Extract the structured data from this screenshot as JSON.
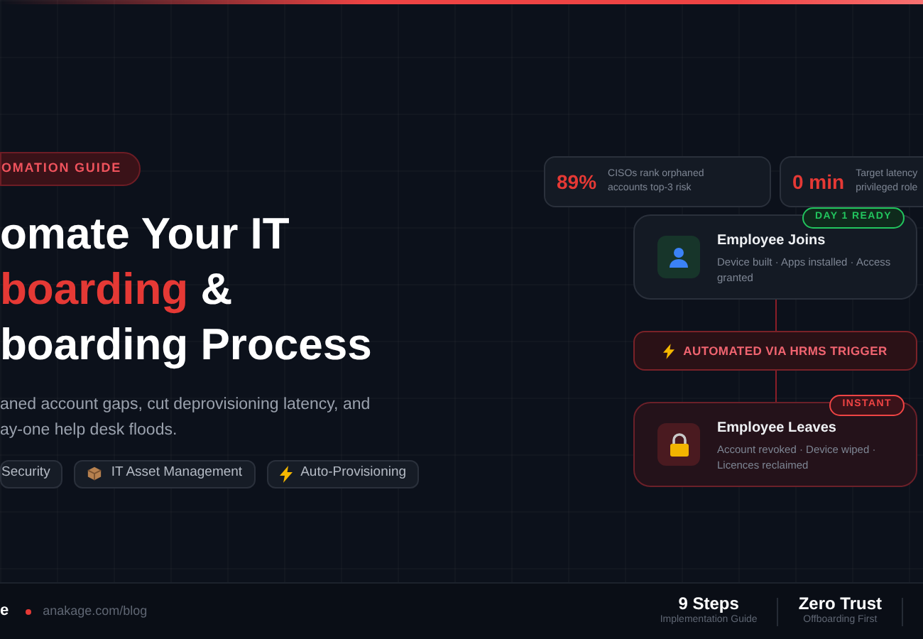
{
  "badge": "OMATION GUIDE",
  "title_lines": [
    {
      "segments": [
        {
          "text": "omate Your IT",
          "accent": false
        }
      ]
    },
    {
      "segments": [
        {
          "text": "boarding",
          "accent": true
        },
        {
          "text": " &",
          "accent": false
        }
      ]
    },
    {
      "segments": [
        {
          "text": "boarding Process",
          "accent": false
        }
      ]
    }
  ],
  "description_lines": [
    "aned account gaps, cut deprovisioning latency, and",
    "ay-one help desk floods."
  ],
  "tags": [
    {
      "kind": "plain",
      "label": "Security"
    },
    {
      "kind": "box",
      "label": "IT Asset Management"
    },
    {
      "kind": "bolt",
      "label": "Auto-Provisioning"
    }
  ],
  "stats": [
    {
      "value": "89%",
      "caption_lines": [
        "CISOs rank orphaned",
        "accounts top-3 risk"
      ]
    },
    {
      "value": "0 min",
      "caption_lines": [
        "Target latency",
        "privileged role"
      ]
    }
  ],
  "flow": [
    {
      "kind": "onboard",
      "title": "Employee Joins",
      "description": "Device built · Apps installed · Access granted",
      "badge": "DAY 1 READY",
      "color": "#22c55e"
    },
    {
      "kind": "trigger",
      "title": "AUTOMATED VIA HRMS TRIGGER"
    },
    {
      "kind": "offboard",
      "title": "Employee Leaves",
      "description": "Account revoked · Device wiped · Licences reclaimed",
      "badge": "INSTANT",
      "color": "#ef4444"
    }
  ],
  "footer": {
    "logo": "e",
    "url": "anakage.com/blog",
    "stats": [
      {
        "value": "9 Steps",
        "label": "Implementation Guide"
      },
      {
        "value": "Zero Trust",
        "label": "Offboarding First"
      }
    ]
  }
}
